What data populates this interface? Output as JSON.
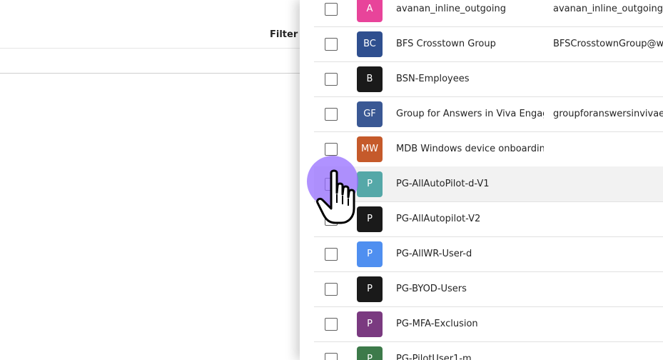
{
  "background": {
    "filter_label": "Filter m"
  },
  "groups": [
    {
      "initials": "A",
      "color": "#e8449a",
      "name": "avanan_inline_outgoing",
      "email": "avanan_inline_outgoing@wo"
    },
    {
      "initials": "BC",
      "color": "#2f4f8f",
      "name": "BFS Crosstown Group",
      "email": "BFSCrosstownGroup@worl"
    },
    {
      "initials": "B",
      "color": "#1a1a1a",
      "name": "BSN-Employees",
      "email": ""
    },
    {
      "initials": "GF",
      "color": "#3a5894",
      "name": "Group for Answers in Viva Engage –",
      "email": "groupforanswersinvivaenga"
    },
    {
      "initials": "MW",
      "color": "#c55a2b",
      "name": "MDB Windows device onboarding g",
      "email": ""
    },
    {
      "initials": "P",
      "color": "#55a8a8",
      "name": "PG-AllAutoPilot-d-V1",
      "email": ""
    },
    {
      "initials": "P",
      "color": "#1a1a1a",
      "name": "PG-AllAutopilot-V2",
      "email": ""
    },
    {
      "initials": "P",
      "color": "#4f8ff0",
      "name": "PG-AllWR-User-d",
      "email": ""
    },
    {
      "initials": "P",
      "color": "#1a1a1a",
      "name": "PG-BYOD-Users",
      "email": ""
    },
    {
      "initials": "P",
      "color": "#7a3a80",
      "name": "PG-MFA-Exclusion",
      "email": ""
    },
    {
      "initials": "P",
      "color": "#3d7a4a",
      "name": "PG-PilotUser1-m",
      "email": ""
    }
  ],
  "hovered_index": 5
}
